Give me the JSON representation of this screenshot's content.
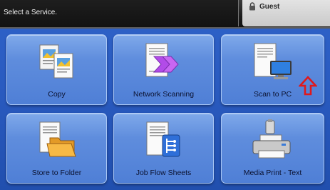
{
  "header": {
    "prompt": "Select a Service.",
    "user_label": "Guest"
  },
  "services": [
    {
      "label": "Copy",
      "icon": "copy-icon"
    },
    {
      "label": "Network Scanning",
      "icon": "network-scanning-icon"
    },
    {
      "label": "Scan to PC",
      "icon": "scan-to-pc-icon"
    },
    {
      "label": "Store to Folder",
      "icon": "store-to-folder-icon"
    },
    {
      "label": "Job Flow Sheets",
      "icon": "job-flow-sheets-icon"
    },
    {
      "label": "Media Print - Text",
      "icon": "media-print-icon"
    }
  ],
  "annotation": {
    "icon": "red-up-arrow-icon",
    "color": "#e0181c"
  },
  "colors": {
    "background": "#2a5bc0",
    "tile": "#5f8ddd",
    "accent_purple": "#b24be8"
  }
}
